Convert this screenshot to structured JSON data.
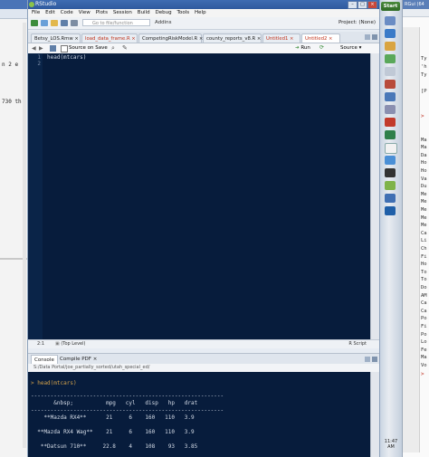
{
  "left_window": {
    "fragments": [
      "n 2 e",
      "730 th"
    ]
  },
  "rstudio": {
    "title": "RStudio",
    "menu": [
      "File",
      "Edit",
      "Code",
      "View",
      "Plots",
      "Session",
      "Build",
      "Debug",
      "Tools",
      "Help"
    ],
    "toolbar": {
      "goto_placeholder": "Go to file/function",
      "addins_label": "Addins",
      "project_label": "Project: (None)"
    },
    "editor_tabs": [
      {
        "label": "Betsy_LOS.Rmw",
        "color": "normal"
      },
      {
        "label": "load_data_frame.R",
        "color": "red"
      },
      {
        "label": "CompetingRiskModel.R",
        "color": "normal"
      },
      {
        "label": "county_reports_v8.R",
        "color": "normal"
      },
      {
        "label": "Untitled1",
        "color": "red"
      },
      {
        "label": "Untitled2",
        "color": "red",
        "active": true
      }
    ],
    "editor_toolbar": {
      "source_on_save": "Source on Save",
      "run_label": "Run",
      "source_label": "Source"
    },
    "code_lines": [
      {
        "num": "1",
        "text": "head(mtcars)"
      },
      {
        "num": "2",
        "text": ""
      }
    ],
    "status": {
      "position": "2:1",
      "scope": "(Top Level)",
      "filetype": "R Script"
    },
    "console_tabs": [
      "Console",
      "Compile PDF"
    ],
    "console_path": "S:/Data Portal/joe_partially_sorted/utah_special_ed/",
    "console": {
      "command": "> head(mtcars)",
      "rule": "-----------------------------------------------------------",
      "header": "       &nbsp;          mpg   cyl   disp   hp   drat",
      "rule2": "-----------------------------------------------------------",
      "rows": [
        "    **Mazda RX4**      21     6    160   110   3.9",
        "  **Mazda RX4 Wag**    21     6    160   110   3.9",
        "   **Datsun 710**     22.8    4    108    93   3.85"
      ]
    }
  },
  "taskbar": {
    "start_label": "Start",
    "clock": "11:47 AM"
  },
  "right_window": {
    "title": "RGui (64",
    "lines": [
      "Ty",
      "'h",
      "Ty",
      "",
      "[P",
      "",
      "",
      ">",
      "",
      "",
      "Ma",
      "Ma",
      "Da",
      "Ho",
      "Ho",
      "Va",
      "Du",
      "Me",
      "Me",
      "Me",
      "Me",
      "Me",
      "Ca",
      "Li",
      "Ch",
      "Fi",
      "Ho",
      "To",
      "To",
      "Do",
      "AM",
      "Ca",
      "Ca",
      "Po",
      "Fi",
      "Po",
      "Lo",
      "Fe",
      "Ma",
      "Vo",
      ">"
    ]
  },
  "colors": {
    "editor_bg": "#071c3c",
    "prompt_orange": "#d4a24a",
    "tab_red": "#c03018"
  }
}
